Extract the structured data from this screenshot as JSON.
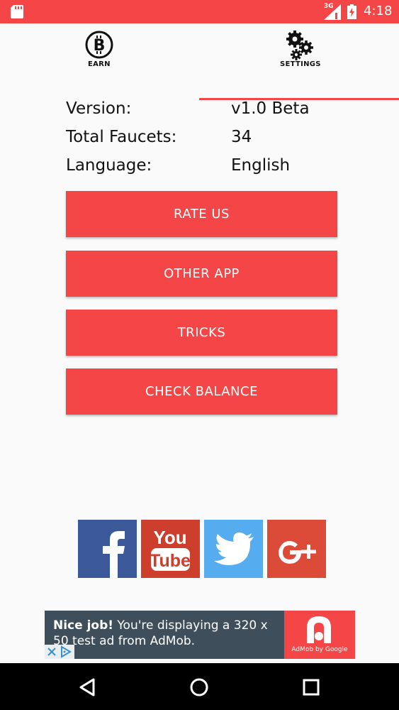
{
  "status_bar": {
    "network": "3G",
    "time": "4:18",
    "color": "#f44646"
  },
  "tabs": [
    {
      "label": "EARN",
      "icon": "bitcoin-icon"
    },
    {
      "label": "SETTINGS",
      "icon": "gears-icon",
      "selected": true
    }
  ],
  "info": [
    {
      "label": "Version:",
      "value": "v1.0 Beta"
    },
    {
      "label": "Total Faucets:",
      "value": "34"
    },
    {
      "label": "Language:",
      "value": "English"
    }
  ],
  "buttons": {
    "rate_us": "RATE US",
    "other_app": "OTHER APP",
    "tricks": "TRICKS",
    "check_balance": "CHECK BALANCE"
  },
  "social": [
    {
      "name": "facebook-icon",
      "color": "#3b5998"
    },
    {
      "name": "youtube-icon",
      "color": "#cd3e2c"
    },
    {
      "name": "twitter-icon",
      "color": "#55acee"
    },
    {
      "name": "google-plus-icon",
      "color": "#dc4a38"
    }
  ],
  "ad": {
    "bold": "Nice job!",
    "text": " You're displaying a 320 x 50 test ad from AdMob.",
    "caption": "AdMob by Google"
  },
  "accent_color": "#f44646"
}
